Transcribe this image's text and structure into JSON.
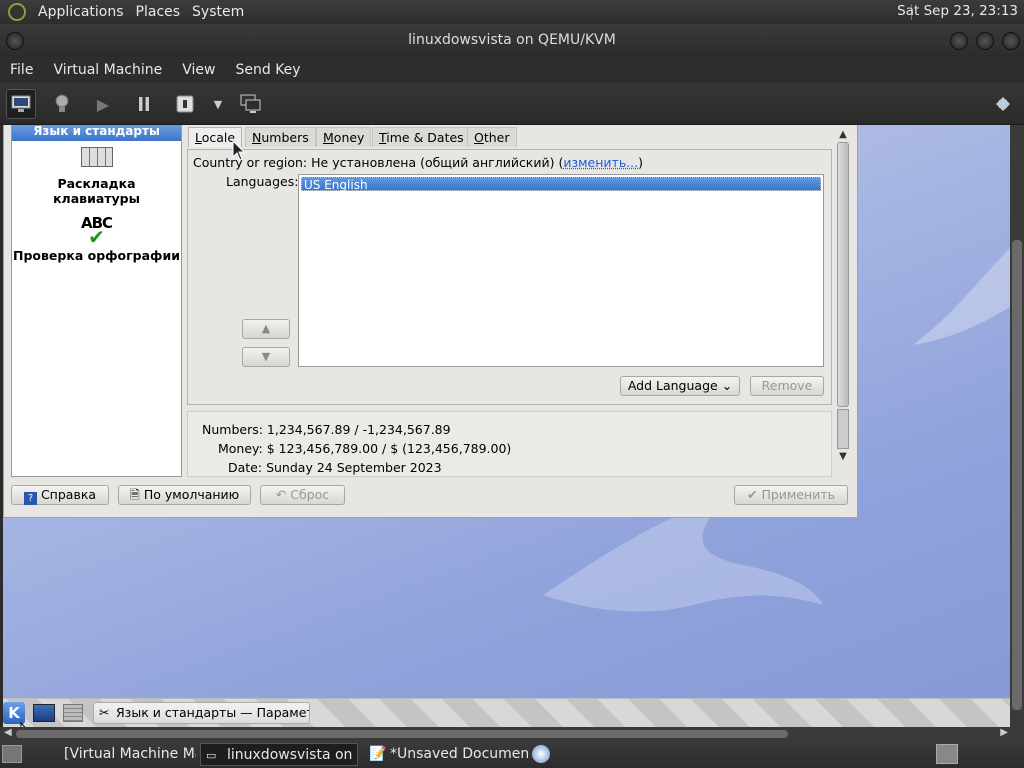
{
  "top_panel": {
    "menus": [
      "Applications",
      "Places",
      "System"
    ],
    "clock": "Sat Sep 23, 23:13"
  },
  "window": {
    "title": "linuxdowsvista on QEMU/KVM"
  },
  "menubar": [
    "File",
    "Virtual Machine",
    "View",
    "Send Key"
  ],
  "toolbar": {
    "icons": [
      "console-icon",
      "lightbulb-icon",
      "play-icon",
      "pause-icon",
      "power-icon",
      "dropdown-icon",
      "snapshot-icon",
      "fullscreen-icon"
    ]
  },
  "guest": {
    "sidebar": {
      "selected": "Язык и стандарты",
      "items": [
        "Раскладка клавиатуры",
        "Проверка орфографии"
      ],
      "abc_label": "ABC"
    },
    "tabs": [
      {
        "pre": "",
        "u": "L",
        "post": "ocale"
      },
      {
        "pre": "",
        "u": "N",
        "post": "umbers"
      },
      {
        "pre": "",
        "u": "M",
        "post": "oney"
      },
      {
        "pre": "",
        "u": "T",
        "post": "ime & Dates"
      },
      {
        "pre": "",
        "u": "O",
        "post": "ther"
      }
    ],
    "region_label": "Country or region:",
    "region_value": "Не установлена (общий английский) (",
    "region_link": "изменить...",
    "region_end": ")",
    "languages_label": "Languages:",
    "languages": [
      "US English"
    ],
    "add_language": "Add Language",
    "remove": "Remove",
    "info": {
      "numbers_label": "Numbers:",
      "numbers": "1,234,567.89 / -1,234,567.89",
      "money_label": "Money:",
      "money": "$ 123,456,789.00 / $ (123,456,789.00)",
      "date_label": "Date:",
      "date": "Sunday 24 September 2023"
    },
    "buttons": {
      "help": "Справка",
      "defaults": "По умолчанию",
      "reset": "Сброс",
      "apply": "Применить"
    },
    "kde_task": "Язык и стандарты — Параметры"
  },
  "taskbar": {
    "items": [
      "[Virtual Machine Ma...",
      "linuxdowsvista on ...",
      "*Unsaved Documen..."
    ]
  },
  "colors": {
    "accent": "#3c76cc",
    "link": "#1e5bd6"
  }
}
